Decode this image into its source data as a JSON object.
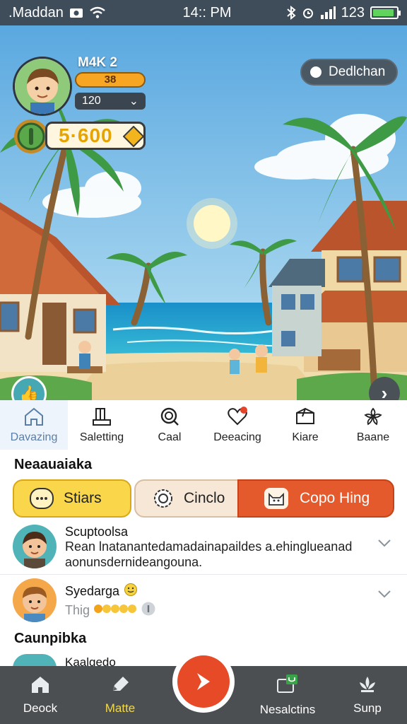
{
  "status_bar": {
    "carrier": ".Maddan",
    "time": "14:: PM",
    "battery_text": "123",
    "battery_level": 0.9
  },
  "player": {
    "name": "M4K 2",
    "xp_value": "38",
    "level_value": "120",
    "coins": "5·600"
  },
  "mode_chip": {
    "label": "Dedlchan"
  },
  "categories": [
    {
      "label": "Davazing",
      "icon": "home-icon",
      "active": true
    },
    {
      "label": "Saletting",
      "icon": "building-icon",
      "active": false
    },
    {
      "label": "Caal",
      "icon": "search-icon",
      "active": false
    },
    {
      "label": "Deeacing",
      "icon": "heart-icon",
      "active": false
    },
    {
      "label": "Kiare",
      "icon": "box-icon",
      "active": false
    },
    {
      "label": "Baane",
      "icon": "flower-icon",
      "active": false
    }
  ],
  "section_1_title": "Neaauaiaka",
  "actions": {
    "yellow": "Stiars",
    "beige": "Cinclo",
    "orange": "Copo Hing"
  },
  "list": [
    {
      "title": "Scuptoolsa",
      "line1": "Rean lnatanantedamadainapaildes a.ehinglueanad",
      "line2": "aonunsdernideangouna."
    },
    {
      "title": "Syedarga",
      "sub": "Thig"
    }
  ],
  "section_2_title": "Caunpibka",
  "list_partial": {
    "title": "Kaalgedo"
  },
  "bottom_nav": {
    "item1": "Deock",
    "item2": "Matte",
    "item3": "Nesalctins",
    "item4": "Sunp"
  },
  "colors": {
    "accent_orange": "#e45a2c",
    "accent_yellow": "#f9d64a",
    "nav_bg": "#4b4f52",
    "status_bar_bg": "#3f4d5a"
  }
}
